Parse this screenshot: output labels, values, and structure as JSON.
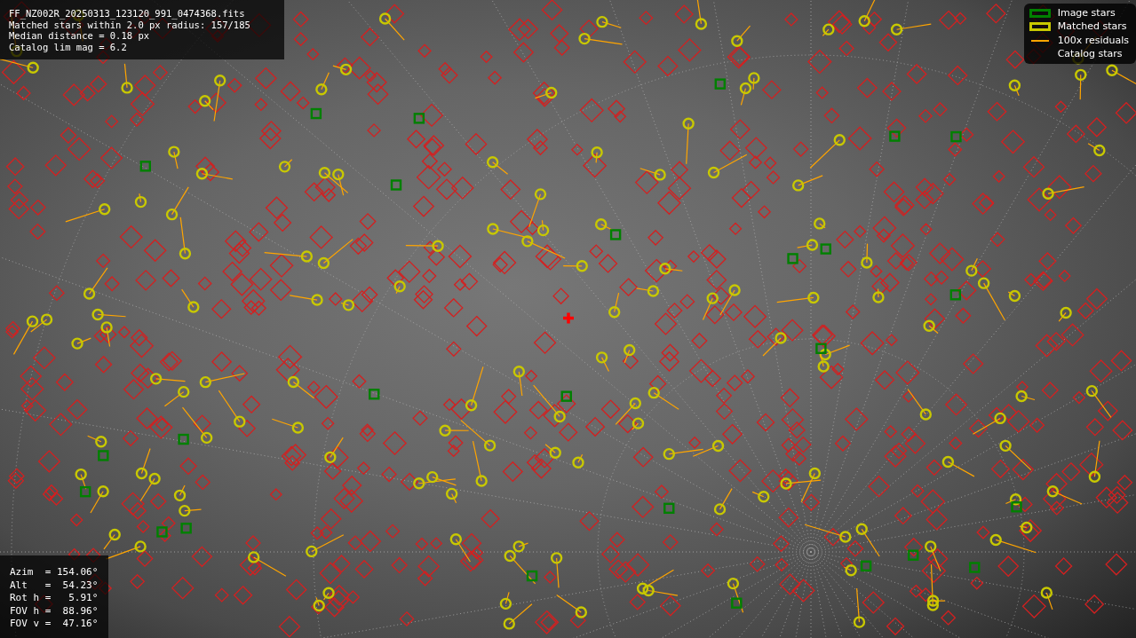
{
  "image_info": {
    "lines": [
      "FF_NZ002R_20250313_123120_991_0474368.fits",
      "Matched stars within 2.0 px radius: 157/185",
      "Median distance = 0.18 px",
      "Catalog lim mag = 6.2"
    ]
  },
  "legend": {
    "items": [
      {
        "label": "Image stars",
        "kind": "box",
        "color": "#008000"
      },
      {
        "label": "Matched stars",
        "kind": "box",
        "color": "#c8c800"
      },
      {
        "label": "100x residuals",
        "kind": "line",
        "color": "#ffa500"
      },
      {
        "label": "Catalog stars",
        "kind": "blank"
      }
    ]
  },
  "pointing": {
    "lines": [
      "Azim  = 154.06°",
      "Alt   =  54.23°",
      "Rot h =   5.91°",
      "FOV h =  88.96°",
      "FOV v =  47.16°"
    ]
  }
}
